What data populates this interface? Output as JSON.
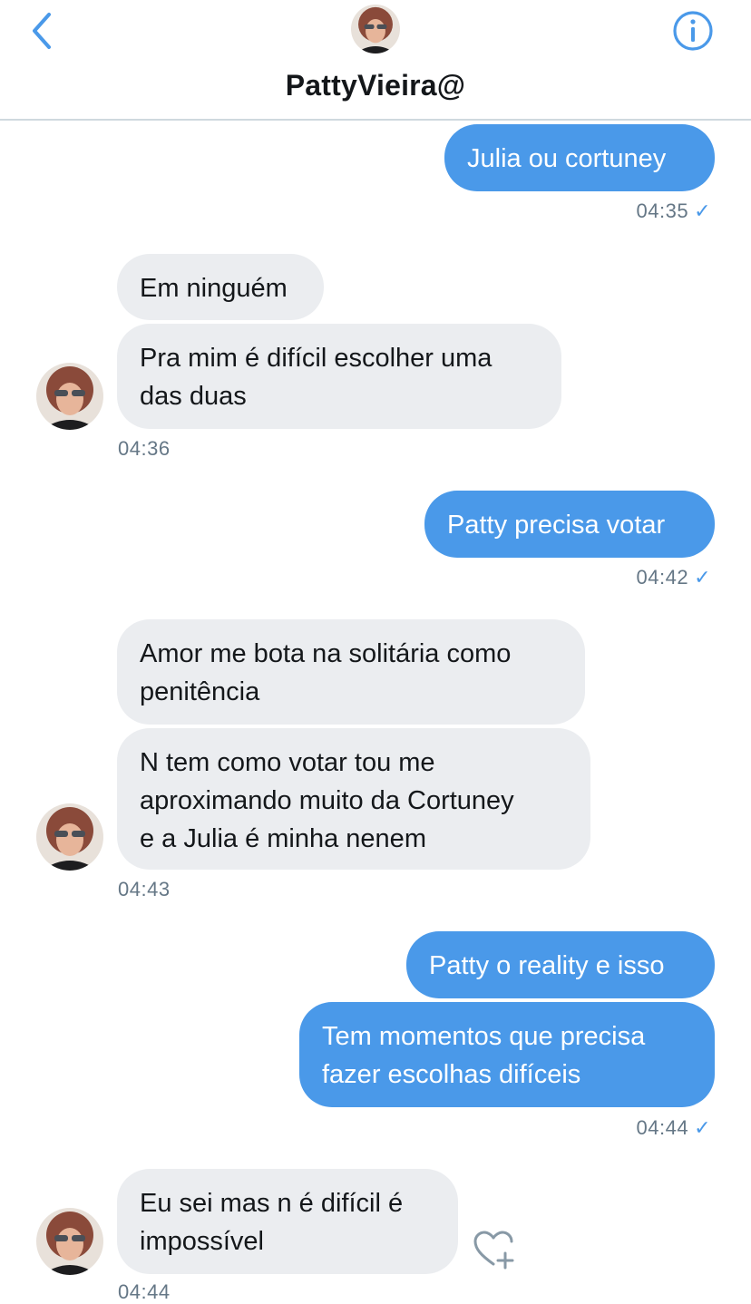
{
  "header": {
    "title": "PattyVieira@",
    "back_icon": "chevron-left-icon",
    "info_icon": "info-circle-icon",
    "accent_color": "#4a99e9"
  },
  "messages": [
    {
      "dir": "out",
      "lines": [
        "Julia ou cortuney"
      ],
      "time": "04:35",
      "status": "✓"
    },
    {
      "dir": "in",
      "lines": [
        "Em ninguém"
      ]
    },
    {
      "dir": "in",
      "lines": [
        "Pra mim é difícil escolher uma",
        "das duas"
      ],
      "time": "04:36"
    },
    {
      "dir": "out",
      "lines": [
        "Patty precisa votar"
      ],
      "time": "04:42",
      "status": "✓"
    },
    {
      "dir": "in",
      "lines": [
        "Amor me bota na solitária como",
        "penitência"
      ]
    },
    {
      "dir": "in",
      "lines": [
        "N tem como votar tou me",
        "aproximando muito da Cortuney",
        "e a Julia é minha nenem"
      ],
      "time": "04:43"
    },
    {
      "dir": "out",
      "lines": [
        "Patty o reality e isso"
      ]
    },
    {
      "dir": "out",
      "lines": [
        "Tem momentos que precisa",
        "fazer escolhas difíceis"
      ],
      "time": "04:44",
      "status": "✓"
    },
    {
      "dir": "in",
      "lines": [
        "Eu sei mas n é difícil é",
        "impossível"
      ],
      "time": "04:44"
    }
  ],
  "colors": {
    "outgoing": "#4a99e9",
    "incoming": "#ebedf0",
    "timestamp": "#657786"
  }
}
